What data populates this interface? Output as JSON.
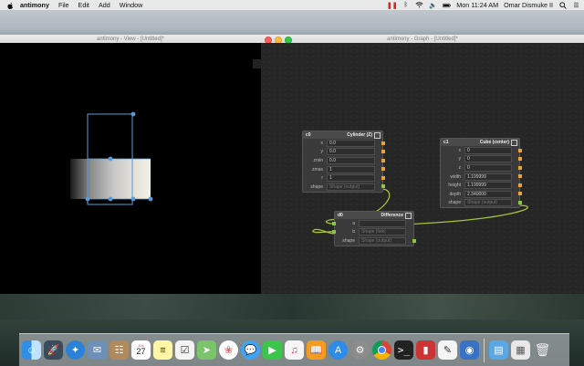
{
  "menubar": {
    "app_name": "antimony",
    "menus": [
      "File",
      "Edit",
      "Add",
      "Window"
    ],
    "clock": "Mon 11:24 AM",
    "user": "Omar Dismuke II"
  },
  "view_window": {
    "title": "antimony - View - [Untitled]*"
  },
  "graph_window": {
    "title": "antimony - Graph - [Untitled]*"
  },
  "nodes": {
    "cylinder": {
      "name": "c0",
      "type": "Cylinder (Z)",
      "rows": [
        {
          "label": "x",
          "value": "0.0"
        },
        {
          "label": "y",
          "value": "0.0"
        },
        {
          "label": "zmin",
          "value": "0.0"
        },
        {
          "label": "zmax",
          "value": "1"
        },
        {
          "label": "r",
          "value": "1"
        },
        {
          "label": "shape",
          "value": "Shape (output)"
        }
      ]
    },
    "cube": {
      "name": "c1",
      "type": "Cube (center)",
      "rows": [
        {
          "label": "x",
          "value": "0"
        },
        {
          "label": "y",
          "value": "0"
        },
        {
          "label": "z",
          "value": "0"
        },
        {
          "label": "width",
          "value": "1.199999"
        },
        {
          "label": "height",
          "value": "1.199999"
        },
        {
          "label": "depth",
          "value": "2.340000"
        },
        {
          "label": "shape",
          "value": "Shape (output)"
        }
      ]
    },
    "difference": {
      "name": "d0",
      "type": "Difference",
      "rows": [
        {
          "label": "a",
          "value": ""
        },
        {
          "label": "b",
          "value": "Shape (link)"
        },
        {
          "label": "shape",
          "value": "Shape (output)"
        }
      ]
    }
  },
  "colors": {
    "accent_port": "#e9a23b",
    "shape_port": "#8bc34a",
    "wire": "#a8c23a",
    "bbox": "#5b9bd5"
  },
  "dock": {
    "icons": [
      "finder-icon",
      "launchpad-icon",
      "safari-icon",
      "mail-icon",
      "contacts-icon",
      "calendar-icon",
      "notes-icon",
      "reminders-icon",
      "maps-icon",
      "photos-icon",
      "messages-icon",
      "facetime-icon",
      "itunes-icon",
      "ibooks-icon",
      "app-store-icon",
      "system-preferences-icon",
      "chrome-icon",
      "terminal-icon",
      "antimony-icon",
      "textedit-icon",
      "preview-icon",
      "applications-folder-icon",
      "documents-folder-icon",
      "trash-icon"
    ],
    "calendar_day": "27",
    "calendar_month": "JUL"
  }
}
